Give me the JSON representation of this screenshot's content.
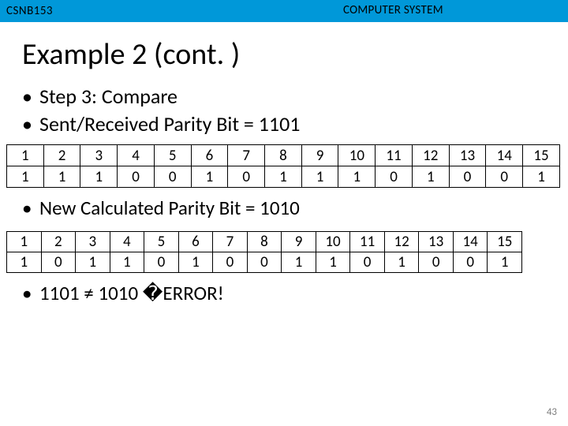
{
  "header": {
    "course_code": "CSNB153",
    "course_title": "COMPUTER SYSTEM"
  },
  "title": "Example 2 (cont. )",
  "bullets_top": [
    "Step 3: Compare",
    "Sent/Received Parity Bit = 1101"
  ],
  "table1": {
    "headers": [
      "1",
      "2",
      "3",
      "4",
      "5",
      "6",
      "7",
      "8",
      "9",
      "10",
      "11",
      "12",
      "13",
      "14",
      "15"
    ],
    "values": [
      "1",
      "1",
      "1",
      "0",
      "0",
      "1",
      "0",
      "1",
      "1",
      "1",
      "0",
      "1",
      "0",
      "0",
      "1"
    ]
  },
  "bullet_mid": "New Calculated Parity Bit = 1010",
  "table2": {
    "headers": [
      "1",
      "2",
      "3",
      "4",
      "5",
      "6",
      "7",
      "8",
      "9",
      "10",
      "11",
      "12",
      "13",
      "14",
      "15"
    ],
    "values": [
      "1",
      "0",
      "1",
      "1",
      "0",
      "1",
      "0",
      "0",
      "1",
      "1",
      "0",
      "1",
      "0",
      "0",
      "1"
    ]
  },
  "bullet_bottom": "1101 ≠ 1010 �ERROR!",
  "page_number": "43",
  "chart_data": {
    "type": "table",
    "description": "Two 2x15 bit tables showing position indices 1-15 and corresponding bit values for sent/received vs newly calculated parity words.",
    "tables": [
      {
        "label": "Sent/Received",
        "positions": [
          1,
          2,
          3,
          4,
          5,
          6,
          7,
          8,
          9,
          10,
          11,
          12,
          13,
          14,
          15
        ],
        "bits": [
          1,
          1,
          1,
          0,
          0,
          1,
          0,
          1,
          1,
          1,
          0,
          1,
          0,
          0,
          1
        ]
      },
      {
        "label": "New Calculated",
        "positions": [
          1,
          2,
          3,
          4,
          5,
          6,
          7,
          8,
          9,
          10,
          11,
          12,
          13,
          14,
          15
        ],
        "bits": [
          1,
          0,
          1,
          1,
          0,
          1,
          0,
          0,
          1,
          1,
          0,
          1,
          0,
          0,
          1
        ]
      }
    ],
    "comparison": {
      "sent_parity": "1101",
      "calc_parity": "1010",
      "equal": false
    }
  }
}
